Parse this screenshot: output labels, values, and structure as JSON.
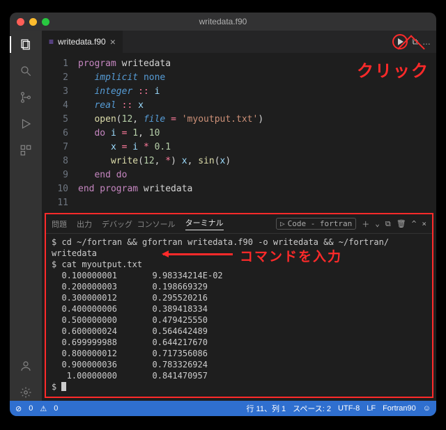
{
  "window": {
    "title": "writedata.f90"
  },
  "tab": {
    "icon": "≡",
    "name": "writedata.f90",
    "close": "×"
  },
  "tab_actions": {
    "split": "⧉",
    "more": "…"
  },
  "annotations": {
    "click": "クリック",
    "input_command": "コマンドを入力"
  },
  "code": {
    "lines": [
      {
        "n": "1",
        "html": "<span class='tok-kw2'>program</span> writedata"
      },
      {
        "n": "2",
        "html": "   <span class='tok-ital'>implicit</span> <span class='tok-kw'>none</span>"
      },
      {
        "n": "3",
        "html": "   <span class='tok-ital'>integer</span> <span class='tok-op'>::</span> <span class='tok-var'>i</span>"
      },
      {
        "n": "4",
        "html": "   <span class='tok-ital'>real</span> <span class='tok-op'>::</span> <span class='tok-var'>x</span>"
      },
      {
        "n": "5",
        "html": "   <span class='tok-fn'>open</span>(<span class='tok-num'>12</span>, <span class='tok-ital'>file</span> <span class='tok-op'>=</span> <span class='tok-str'>'myoutput.txt'</span>)"
      },
      {
        "n": "6",
        "html": "   <span class='tok-kw2'>do</span> <span class='tok-var'>i</span> <span class='tok-op'>=</span> <span class='tok-num'>1</span>, <span class='tok-num'>10</span>"
      },
      {
        "n": "7",
        "html": "      <span class='tok-var'>x</span> <span class='tok-op'>=</span> <span class='tok-var'>i</span> <span class='tok-op'>*</span> <span class='tok-num'>0.1</span>"
      },
      {
        "n": "8",
        "html": "      <span class='tok-fn'>write</span>(<span class='tok-num'>12</span>, <span class='tok-op'>*</span>) <span class='tok-var'>x</span>, <span class='tok-fn'>sin</span>(<span class='tok-var'>x</span>)"
      },
      {
        "n": "9",
        "html": "   <span class='tok-kw2'>end do</span>"
      },
      {
        "n": "10",
        "html": "<span class='tok-kw2'>end program</span> writedata"
      },
      {
        "n": "11",
        "html": ""
      }
    ]
  },
  "terminal": {
    "tabs": {
      "problems": "問題",
      "output": "出力",
      "debug": "デバッグ コンソール",
      "terminal": "ターミナル"
    },
    "right": {
      "kind_label": "Code - fortran",
      "plus": "＋",
      "dropdown": "⌄",
      "split": "⧉",
      "trash": "🗑",
      "chevron": "^",
      "close": "×"
    },
    "lines": [
      "$ cd ~/fortran && gfortran writedata.f90 -o writedata && ~/fortran/",
      "writedata",
      "$ cat myoutput.txt",
      "  0.100000001       9.98334214E-02",
      "  0.200000003       0.198669329",
      "  0.300000012       0.295520216",
      "  0.400000006       0.389418334",
      "  0.500000000       0.479425550",
      "  0.600000024       0.564642489",
      "  0.699999988       0.644217670",
      "  0.800000012       0.717356086",
      "  0.900000036       0.783326924",
      "   1.00000000       0.841470957"
    ],
    "prompt": "$ "
  },
  "status": {
    "err_icon": "⊘",
    "err": "0",
    "warn_icon": "⚠",
    "warn": "0",
    "lncol": "行 11、列 1",
    "spaces": "スペース: 2",
    "encoding": "UTF-8",
    "eol": "LF",
    "lang": "Fortran90",
    "feedback": "☺"
  }
}
